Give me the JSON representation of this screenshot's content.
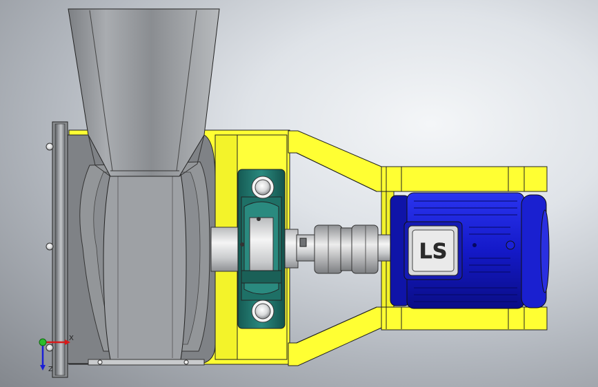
{
  "view": {
    "kind": "3d-cad-model",
    "description_visible": false
  },
  "motor": {
    "logo_text": "LS",
    "color": "#1a22d6"
  },
  "frame": {
    "color": "#ffff33"
  },
  "bearing_block": {
    "color": "#1b6b63"
  },
  "triad": {
    "y_label": "Y",
    "z_label": "Z",
    "x_label": "X"
  }
}
